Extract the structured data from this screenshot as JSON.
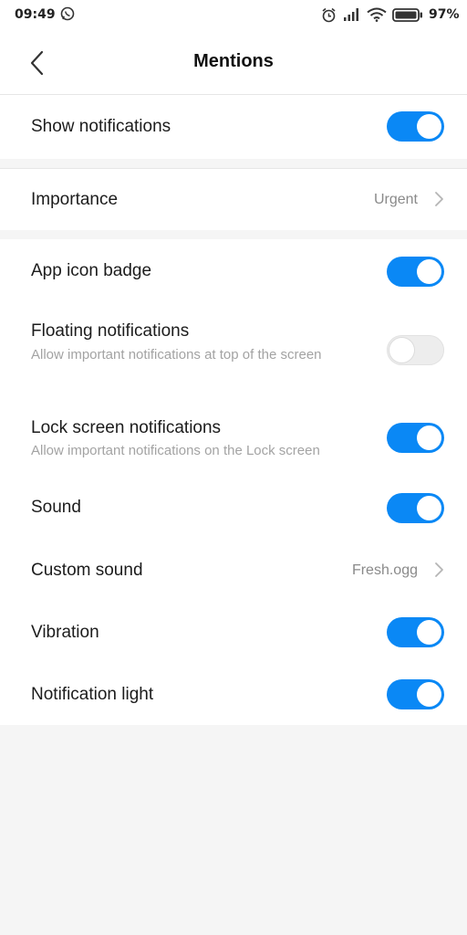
{
  "status_bar": {
    "time": "09:49",
    "battery_percent": "97%"
  },
  "header": {
    "title": "Mentions"
  },
  "settings": {
    "show_notifications": {
      "label": "Show notifications",
      "enabled": true
    },
    "importance": {
      "label": "Importance",
      "value": "Urgent"
    },
    "app_icon_badge": {
      "label": "App icon badge",
      "enabled": true
    },
    "floating_notifications": {
      "label": "Floating notifications",
      "description": "Allow important notifications at top of the screen",
      "enabled": false
    },
    "lock_screen_notifications": {
      "label": "Lock screen notifications",
      "description": "Allow important notifications on the Lock screen",
      "enabled": true
    },
    "sound": {
      "label": "Sound",
      "enabled": true
    },
    "custom_sound": {
      "label": "Custom sound",
      "value": "Fresh.ogg"
    },
    "vibration": {
      "label": "Vibration",
      "enabled": true
    },
    "notification_light": {
      "label": "Notification light",
      "enabled": true
    }
  },
  "colors": {
    "accent": "#0a88f5",
    "background": "#f5f5f5",
    "surface": "#ffffff"
  },
  "icons": [
    "whatsapp-icon",
    "alarm-icon",
    "signal-icon",
    "wifi-icon",
    "battery-icon",
    "back-arrow-icon",
    "chevron-right-icon"
  ]
}
